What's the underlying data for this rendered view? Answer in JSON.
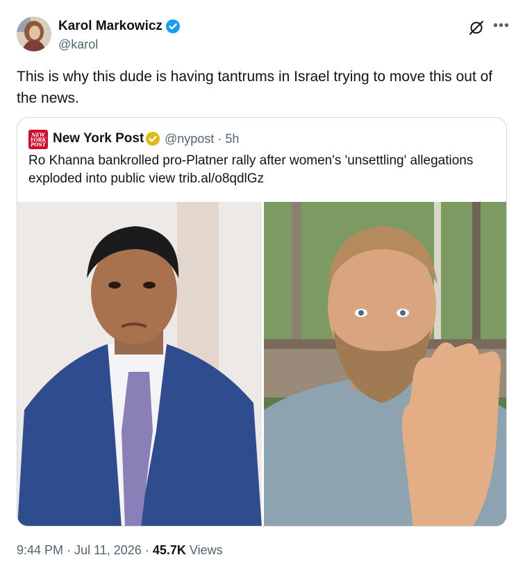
{
  "author": {
    "name": "Karol Markowicz",
    "handle": "@karol",
    "avatar_icon": "user-avatar"
  },
  "tweet": {
    "text": "This is why this dude is having tantrums in Israel trying to move this out of the news."
  },
  "quoted": {
    "logo_text": "NEW YORK POST",
    "name": "New York Post",
    "handle": "@nypost",
    "separator": "·",
    "age": "5h",
    "text": "Ro Khanna bankrolled pro-Platner rally after women's 'unsettling' allegations exploded into public view trib.al/o8qdlGz"
  },
  "footer": {
    "time": "9:44 PM",
    "sep1": "·",
    "date": "Jul 11, 2026",
    "sep2": "·",
    "views_count": "45.7K",
    "views_label": "Views"
  },
  "colors": {
    "verified_blue": "#1d9bf0",
    "verified_gold": "#e2b719",
    "nypost_red": "#c8102e",
    "secondary_text": "#536471"
  }
}
